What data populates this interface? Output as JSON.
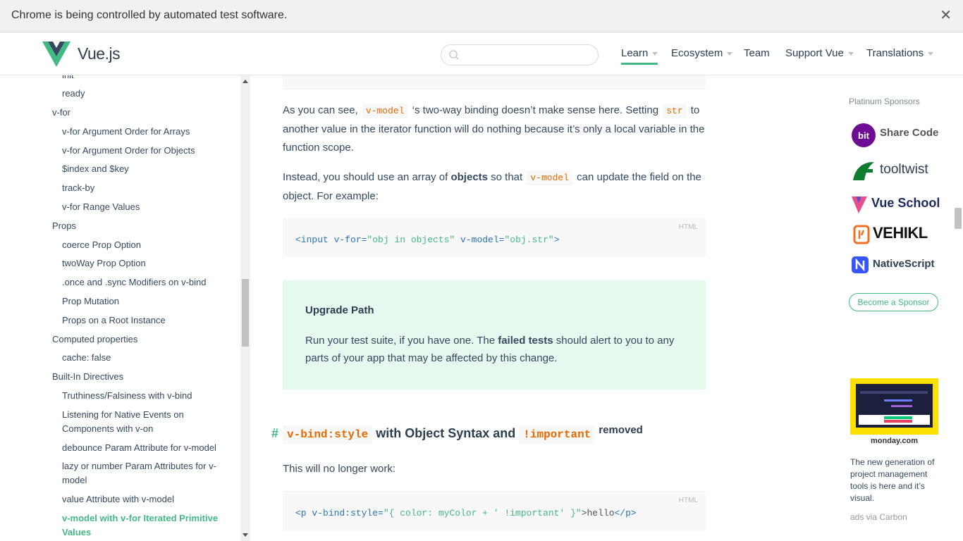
{
  "browser": {
    "automation_message": "Chrome is being controlled by automated test software.",
    "close_glyph": "✕"
  },
  "header": {
    "brand": "Vue.js",
    "search_placeholder": "",
    "nav": [
      {
        "label": "Learn",
        "has_caret": true,
        "active": true
      },
      {
        "label": "Ecosystem",
        "has_caret": true
      },
      {
        "label": "Team",
        "has_caret": false
      },
      {
        "label": "Support Vue",
        "has_caret": true
      },
      {
        "label": "Translations",
        "has_caret": true
      }
    ]
  },
  "sidebar": {
    "items": [
      {
        "label": "init",
        "level": "sub"
      },
      {
        "label": "ready",
        "level": "sub"
      },
      {
        "label": "v-for",
        "level": "top"
      },
      {
        "label": "v-for Argument Order for Arrays",
        "level": "sub"
      },
      {
        "label": "v-for Argument Order for Objects",
        "level": "sub"
      },
      {
        "label": "$index and $key",
        "level": "sub"
      },
      {
        "label": "track-by",
        "level": "sub"
      },
      {
        "label": "v-for Range Values",
        "level": "sub"
      },
      {
        "label": "Props",
        "level": "top"
      },
      {
        "label": "coerce Prop Option",
        "level": "sub"
      },
      {
        "label": "twoWay Prop Option",
        "level": "sub"
      },
      {
        "label": ".once and .sync Modifiers on v-bind",
        "level": "sub"
      },
      {
        "label": "Prop Mutation",
        "level": "sub"
      },
      {
        "label": "Props on a Root Instance",
        "level": "sub"
      },
      {
        "label": "Computed properties",
        "level": "top"
      },
      {
        "label": "cache: false",
        "level": "sub"
      },
      {
        "label": "Built-In Directives",
        "level": "top"
      },
      {
        "label": "Truthiness/Falsiness with v-bind",
        "level": "sub"
      },
      {
        "label": "Listening for Native Events on",
        "level": "sub"
      },
      {
        "label": "Components with v-on",
        "level": "sub"
      },
      {
        "label": "debounce Param Attribute for v-model",
        "level": "sub"
      },
      {
        "label": "lazy or number Param Attributes for v-",
        "level": "sub"
      },
      {
        "label": "model",
        "level": "sub"
      },
      {
        "label": "value Attribute with v-model",
        "level": "sub"
      },
      {
        "label": "v-model with v-for Iterated Primitive",
        "level": "sub",
        "current": true
      },
      {
        "label": "Values",
        "level": "sub",
        "current": true
      }
    ]
  },
  "content": {
    "para1": {
      "t1": "As you can see, ",
      "code1": "v-model",
      "t2": " ‘s two-way binding doesn’t make sense here. Setting ",
      "code2": "str",
      "t3": " to another value in the iterator function will do nothing because it’s only a local variable in the function scope."
    },
    "para2": {
      "t1": "Instead, you should use an array of ",
      "bold": "objects",
      "t2": " so that ",
      "code": "v-model",
      "t3": " can update the field on the object. For example:"
    },
    "code1": {
      "lang": "HTML",
      "p1": "<input",
      "p2": " v-for=",
      "p3": "\"obj in objects\"",
      "p4": " v-model=",
      "p5": "\"obj.str\"",
      "p6": ">"
    },
    "tip": {
      "title": "Upgrade Path",
      "t1": "Run your test suite, if you have one. The ",
      "bold": "failed tests",
      "t2": " should alert to you to any parts of your app that may be affected by this change."
    },
    "heading": {
      "hash": "#",
      "code1": "v-bind:style",
      "mid": " with Object Syntax and ",
      "code2": "!important",
      "tail": "removed"
    },
    "para3": "This will no longer work:",
    "code2": {
      "lang": "HTML",
      "p1": "<p",
      "p2": " v-bind:style=",
      "p3": "\"{ color: myColor + ' !important' }\"",
      "p4": ">hello",
      "p5": "</p>"
    }
  },
  "sponsors": {
    "title": "Platinum Sponsors",
    "items": [
      {
        "name": "Share Code",
        "icon": "bit-logo-icon",
        "color": "#6e0b95"
      },
      {
        "name": "tooltwist",
        "icon": "tooltwist-logo-icon",
        "color": "#0e7d32"
      },
      {
        "name": "Vue School",
        "icon": "vueschool-logo-icon",
        "color": "#1b2a5e"
      },
      {
        "name": "VEHIKL",
        "icon": "vehikl-logo-icon",
        "color": "#f26f21"
      },
      {
        "name": "NativeScript",
        "icon": "nativescript-logo-icon",
        "color": "#3655ff"
      }
    ],
    "become": "Become a Sponsor",
    "ad_brand": "monday.com",
    "ad_text": "The new generation of project management tools is here and it’s visual.",
    "ad_via": "ads via Carbon"
  },
  "colors": {
    "accent": "#42b983",
    "text": "#34495e",
    "code_orange": "#e96900",
    "tip_bg": "#e6f9ef"
  }
}
